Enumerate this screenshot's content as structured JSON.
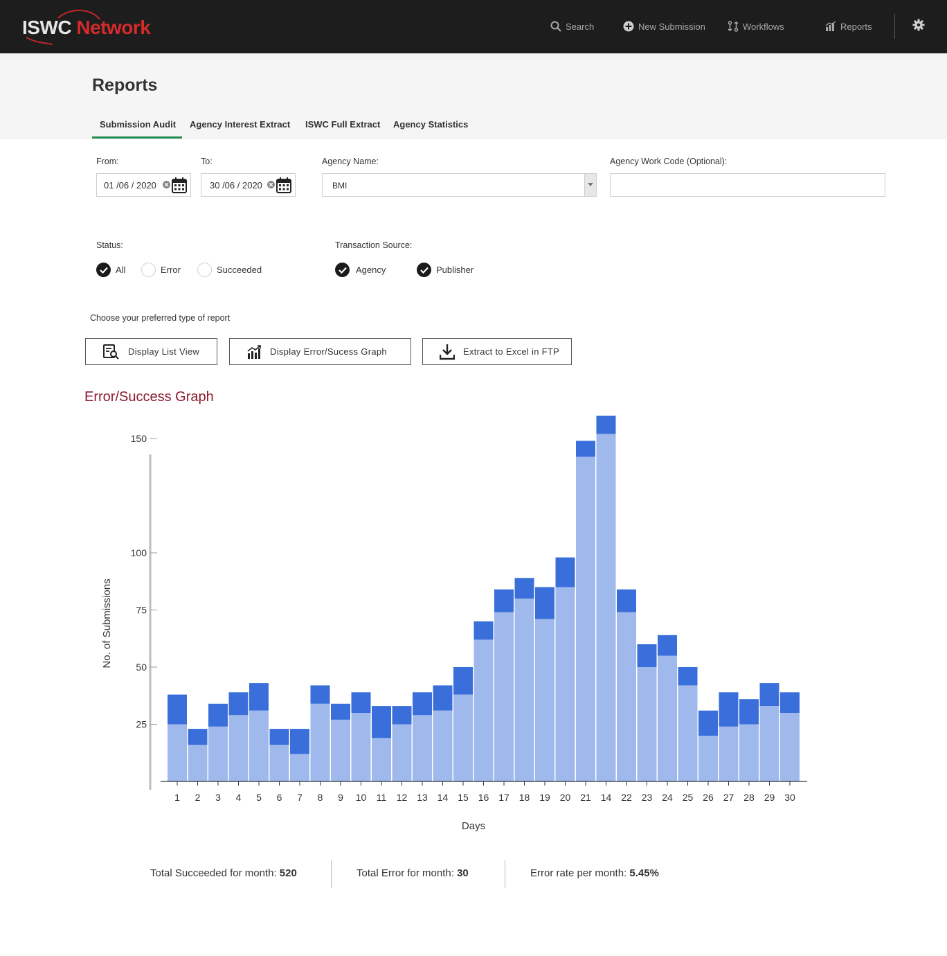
{
  "app": {
    "logo_text_1": "ISWC",
    "logo_text_2": "Network",
    "brand_red": "#d52b2b"
  },
  "nav": {
    "search": "Search",
    "new_submission": "New Submission",
    "workflows": "Workflows",
    "reports": "Reports"
  },
  "page": {
    "title": "Reports",
    "tabs": [
      "Submission Audit",
      "Agency Interest Extract",
      "ISWC Full Extract",
      "Agency Statistics"
    ],
    "active_tab": "Submission Audit"
  },
  "filters": {
    "from_label": "From:",
    "from_value": "01 /06 / 2020",
    "to_label": "To:",
    "to_value": "30 /06 / 2020",
    "agency_name_label": "Agency Name:",
    "agency_name_value": "BMI",
    "work_code_label": "Agency Work Code (Optional):",
    "work_code_value": "",
    "status_label": "Status:",
    "status_options": [
      {
        "label": "All",
        "checked": true
      },
      {
        "label": "Error",
        "checked": false
      },
      {
        "label": "Succeeded",
        "checked": false
      }
    ],
    "source_label": "Transaction Source:",
    "source_options": [
      {
        "label": "Agency",
        "checked": true
      },
      {
        "label": "Publisher",
        "checked": true
      }
    ]
  },
  "report": {
    "prompt": "Choose your preferred type of report",
    "list_view_button": "Display List View",
    "graph_button": "Display Error/Sucess Graph",
    "extract_button": "Extract to Excel in FTP",
    "section_title": "Error/Success Graph"
  },
  "chart_data": {
    "type": "bar",
    "stacked": true,
    "xlabel": "Days",
    "ylabel": "No. of Submissions",
    "yticks": [
      25,
      50,
      75,
      100,
      150
    ],
    "categories": [
      "1",
      "2",
      "3",
      "4",
      "5",
      "6",
      "7",
      "8",
      "9",
      "10",
      "11",
      "12",
      "13",
      "14",
      "15",
      "16",
      "17",
      "18",
      "19",
      "20",
      "21",
      "14",
      "22",
      "23",
      "24",
      "25",
      "26",
      "27",
      "28",
      "29",
      "30"
    ],
    "series": [
      {
        "color": "#a0b9ec",
        "values": [
          25,
          16,
          24,
          29,
          31,
          16,
          12,
          34,
          27,
          30,
          19,
          25,
          29,
          31,
          38,
          62,
          74,
          80,
          71,
          85,
          142,
          152,
          74,
          50,
          55,
          42,
          20,
          24,
          25,
          33,
          30
        ]
      },
      {
        "color": "#3a6fdb",
        "values": [
          13,
          7,
          10,
          10,
          12,
          7,
          11,
          8,
          7,
          9,
          14,
          8,
          10,
          11,
          12,
          8,
          10,
          9,
          14,
          13,
          7,
          8,
          10,
          10,
          9,
          8,
          11,
          15,
          11,
          10,
          9
        ]
      }
    ]
  },
  "stats": {
    "succeeded_label": "Total Succeeded for month: ",
    "succeeded_value": "520",
    "error_label": "Total Error for month: ",
    "error_value": "30",
    "rate_label": "Error rate per month: ",
    "rate_value": "5.45%"
  }
}
